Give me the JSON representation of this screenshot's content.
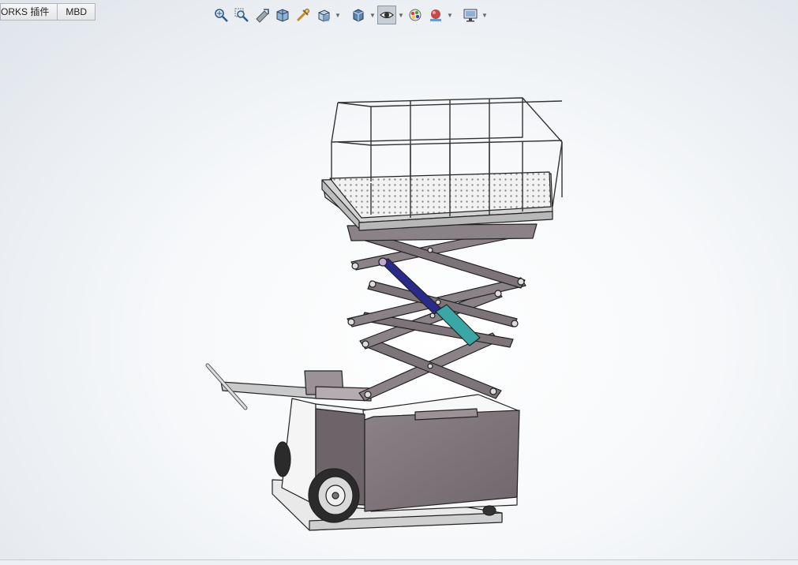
{
  "tabs": [
    {
      "label": "ORKS 插件"
    },
    {
      "label": "MBD"
    }
  ],
  "hud_toolbar": {
    "icons": [
      "zoom-to-fit-icon",
      "zoom-to-area-icon",
      "previous-view-icon",
      "section-view-icon",
      "dynamic-annotation-icon",
      "view-orientation-icon",
      "display-style-icon",
      "hide-show-items-icon",
      "edit-appearance-icon",
      "apply-scene-icon",
      "view-settings-icon"
    ],
    "active": "hide-show-items-icon"
  },
  "model": {
    "name": "scissor lift cart",
    "colors": {
      "body": "#7d7479",
      "body_light": "#a39ca0",
      "body_dark": "#5e575b",
      "frame": "#8a8287",
      "white": "#f4f4f4",
      "cylinder_blue": "#2a2a8a",
      "cylinder_teal": "#3aa7a6",
      "wheel": "#2b2b2b"
    }
  }
}
